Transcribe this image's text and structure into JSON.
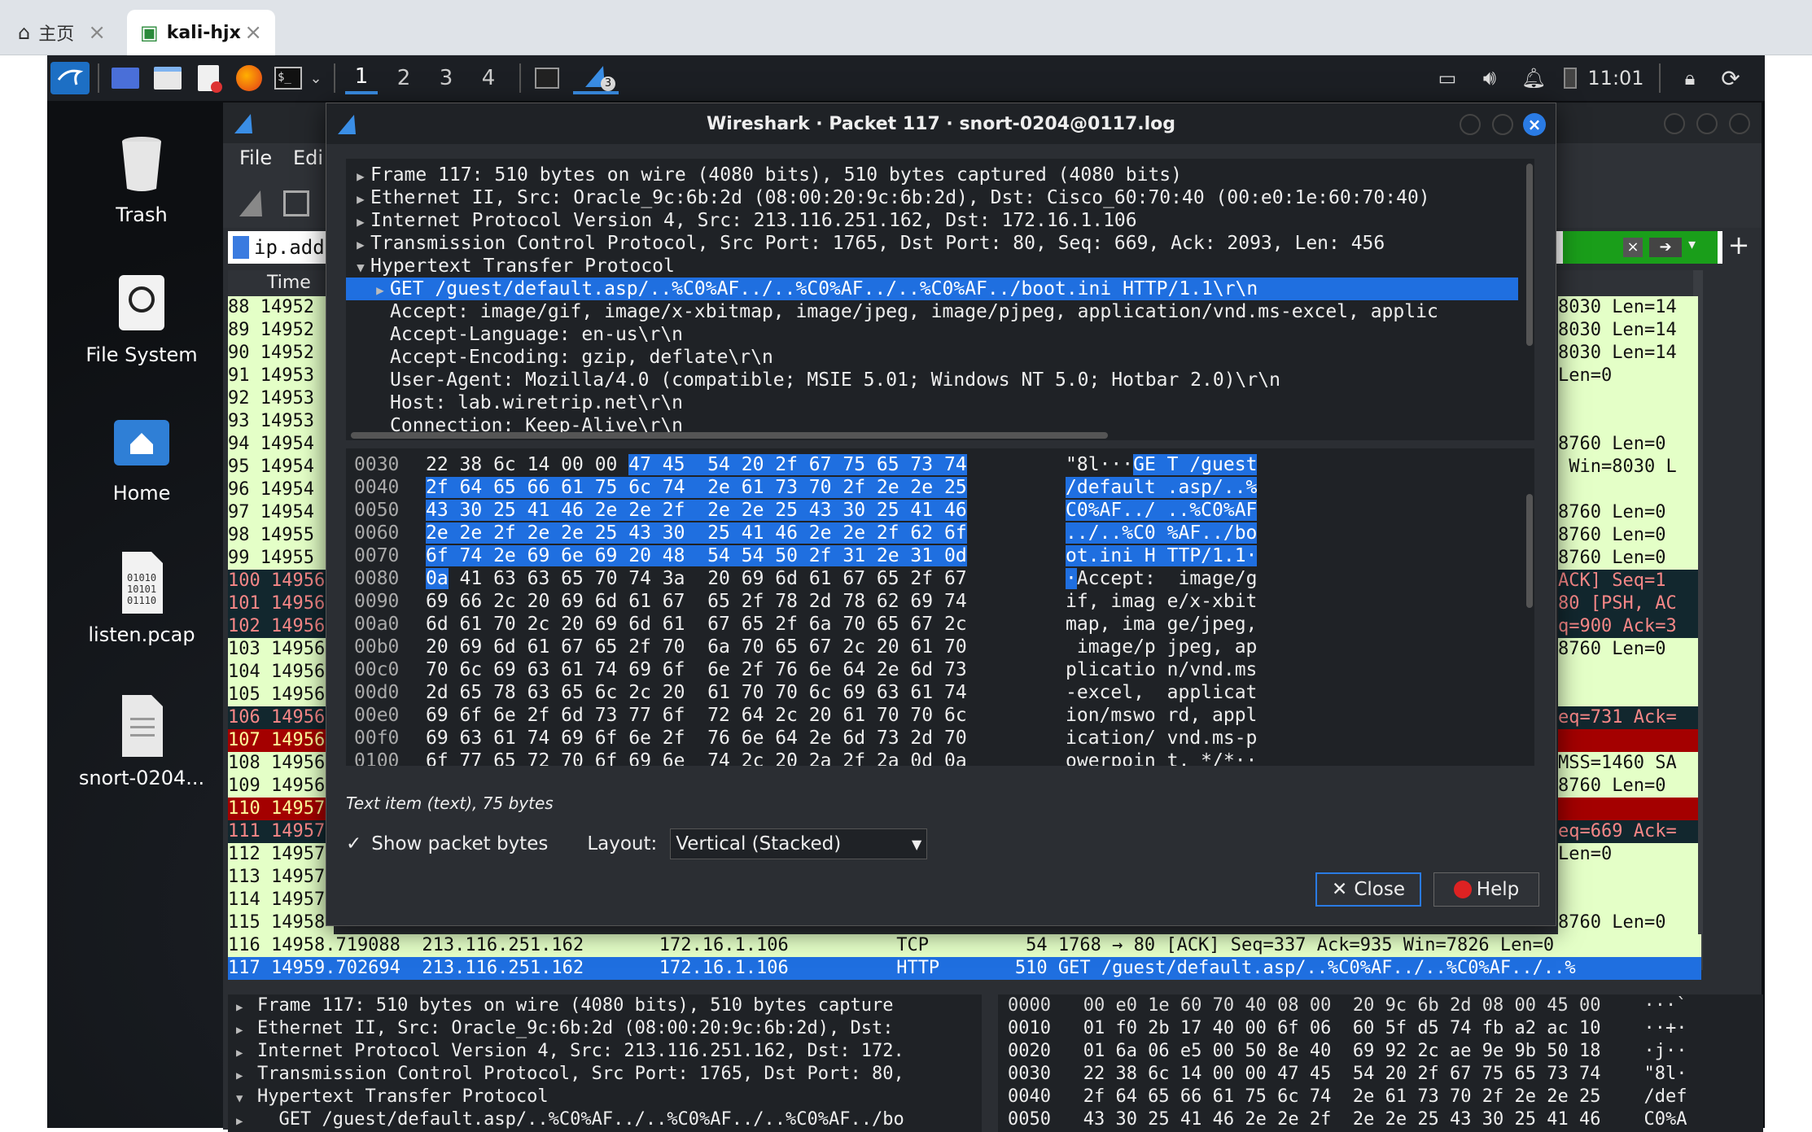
{
  "browser": {
    "tabs": [
      {
        "label": "主页",
        "icon": "home-icon"
      },
      {
        "label": "kali-hjx",
        "icon": "vm-icon"
      }
    ]
  },
  "panel": {
    "workspaces": [
      "1",
      "2",
      "3",
      "4"
    ],
    "wireshark_badge": "3",
    "clock": "11:01"
  },
  "desktop_icons": [
    {
      "label": "Trash",
      "icon": "trash-icon"
    },
    {
      "label": "File System",
      "icon": "drive-icon"
    },
    {
      "label": "Home",
      "icon": "home-folder-icon"
    },
    {
      "label": "listen.pcap",
      "icon": "binary-file-icon"
    },
    {
      "label": "snort-0204...",
      "icon": "text-file-icon"
    }
  ],
  "main": {
    "menu": [
      "File",
      "Edi"
    ],
    "filter_text": "ip.addr",
    "column_time": "Time",
    "rows": [
      {
        "text": "88 14952",
        "info": "8030 Len=14",
        "style": "green"
      },
      {
        "text": "89 14952",
        "info": "8030 Len=14",
        "style": "green"
      },
      {
        "text": "90 14952",
        "info": "8030 Len=14",
        "style": "green"
      },
      {
        "text": "91 14953",
        "info": "Len=0",
        "style": "green"
      },
      {
        "text": "92 14953",
        "info": "",
        "style": "green"
      },
      {
        "text": "93 14953",
        "info": "",
        "style": "green"
      },
      {
        "text": "94 14954",
        "info": "8760 Len=0",
        "style": "green"
      },
      {
        "text": "95 14954",
        "info": " Win=8030 L",
        "style": "green"
      },
      {
        "text": "96 14954",
        "info": "",
        "style": "green"
      },
      {
        "text": "97 14954",
        "info": "8760 Len=0",
        "style": "green"
      },
      {
        "text": "98 14955",
        "info": "8760 Len=0",
        "style": "green"
      },
      {
        "text": "99 14955",
        "info": "8760 Len=0",
        "style": "green"
      },
      {
        "text": "100 14956",
        "info": "ACK] Seq=1",
        "style": "dark"
      },
      {
        "text": "101 14956",
        "info": "80 [PSH, AC",
        "style": "dark"
      },
      {
        "text": "102 14956",
        "info": "q=900 Ack=3",
        "style": "dark"
      },
      {
        "text": "103 14956",
        "info": "8760 Len=0",
        "style": "green"
      },
      {
        "text": "104 14956",
        "info": "",
        "style": "green"
      },
      {
        "text": "105 14956",
        "info": "",
        "style": "green"
      },
      {
        "text": "106 14956",
        "info": "eq=731 Ack=",
        "style": "dark"
      },
      {
        "text": "107 14956",
        "info": "",
        "style": "red"
      },
      {
        "text": "108 14956",
        "info": "MSS=1460 SA",
        "style": "green"
      },
      {
        "text": "109 14956",
        "info": "8760 Len=0",
        "style": "green"
      },
      {
        "text": "110 14957",
        "info": "",
        "style": "red"
      },
      {
        "text": "111 14957",
        "info": "eq=669 Ack=",
        "style": "dark"
      },
      {
        "text": "112 14957",
        "info": "Len=0",
        "style": "green"
      },
      {
        "text": "113 14957",
        "info": "",
        "style": "green"
      },
      {
        "text": "114 14957",
        "info": "",
        "style": "green"
      },
      {
        "text": "115 14958",
        "info": "8760 Len=0",
        "style": "green"
      },
      {
        "text": "116 14958.719088  213.116.251.162       172.16.1.106          TCP         54 1768 → 80 [ACK] Seq=337 Ack=935 Win=7826 Len=0",
        "info": "",
        "style": "green-full"
      },
      {
        "text": "117 14959.702694  213.116.251.162       172.16.1.106          HTTP       510 GET /guest/default.asp/..%C0%AF../..%C0%AF../..%",
        "info": "",
        "style": "sel"
      }
    ],
    "detail_lines": [
      "Frame 117: 510 bytes on wire (4080 bits), 510 bytes capture",
      "Ethernet II, Src: Oracle_9c:6b:2d (08:00:20:9c:6b:2d), Dst:",
      "Internet Protocol Version 4, Src: 213.116.251.162, Dst: 172.",
      "Transmission Control Protocol, Src Port: 1765, Dst Port: 80,",
      "Hypertext Transfer Protocol",
      "  GET /guest/default.asp/..%C0%AF../..%C0%AF../..%C0%AF../bo"
    ],
    "bytes_lines": [
      "0000   00 e0 1e 60 70 40 08 00  20 9c 6b 2d 08 00 45 00    ···`",
      "0010   01 f0 2b 17 40 00 6f 06  60 5f d5 74 fb a2 ac 10    ··+·",
      "0020   01 6a 06 e5 00 50 8e 40  69 92 2c ae 9e 9b 50 18    ·j··",
      "0030   22 38 6c 14 00 00 47 45  54 20 2f 67 75 65 73 74    \"8l·",
      "0040   2f 64 65 66 61 75 6c 74  2e 61 73 70 2f 2e 2e 25    /def",
      "0050   43 30 25 41 46 2e 2e 2f  2e 2e 25 43 30 25 41 46    C0%A"
    ]
  },
  "dialog": {
    "title": "Wireshark · Packet 117 · snort-0204@0117.log",
    "tree": [
      {
        "text": "Frame 117: 510 bytes on wire (4080 bits), 510 bytes captured (4080 bits)",
        "arrow": "▶",
        "indent": 0
      },
      {
        "text": "Ethernet II, Src: Oracle_9c:6b:2d (08:00:20:9c:6b:2d), Dst: Cisco_60:70:40 (00:e0:1e:60:70:40)",
        "arrow": "▶",
        "indent": 0
      },
      {
        "text": "Internet Protocol Version 4, Src: 213.116.251.162, Dst: 172.16.1.106",
        "arrow": "▶",
        "indent": 0
      },
      {
        "text": "Transmission Control Protocol, Src Port: 1765, Dst Port: 80, Seq: 669, Ack: 2093, Len: 456",
        "arrow": "▶",
        "indent": 0
      },
      {
        "text": "Hypertext Transfer Protocol",
        "arrow": "▼",
        "indent": 0
      },
      {
        "text": "GET /guest/default.asp/..%C0%AF../..%C0%AF../..%C0%AF../boot.ini HTTP/1.1\\r\\n",
        "arrow": "▶",
        "indent": 1,
        "selected": true
      },
      {
        "text": "Accept: image/gif, image/x-xbitmap, image/jpeg, image/pjpeg, application/vnd.ms-excel, applic",
        "arrow": "",
        "indent": 1
      },
      {
        "text": "Accept-Language: en-us\\r\\n",
        "arrow": "",
        "indent": 1
      },
      {
        "text": "Accept-Encoding: gzip, deflate\\r\\n",
        "arrow": "",
        "indent": 1
      },
      {
        "text": "User-Agent: Mozilla/4.0 (compatible; MSIE 5.01; Windows NT 5.0; Hotbar 2.0)\\r\\n",
        "arrow": "",
        "indent": 1
      },
      {
        "text": "Host: lab.wiretrip.net\\r\\n",
        "arrow": "",
        "indent": 1
      },
      {
        "text": "Connection: Keep-Alive\\r\\n",
        "arrow": "",
        "indent": 1
      }
    ],
    "bytes": [
      {
        "off": "0030",
        "plain_a": "22 38 6c 14 00 00 ",
        "hl_a": "47 45  54 20 2f 67 75 65 73 74",
        "plain_b": "",
        "asc_plain": "\"8l···",
        "asc_hl": "GE T /guest",
        "asc_rest": ""
      },
      {
        "off": "0040",
        "plain_a": "",
        "hl_a": "2f 64 65 66 61 75 6c 74  2e 61 73 70 2f 2e 2e 25",
        "plain_b": "",
        "asc_plain": "",
        "asc_hl": "/default .asp/..%",
        "asc_rest": ""
      },
      {
        "off": "0050",
        "plain_a": "",
        "hl_a": "43 30 25 41 46 2e 2e 2f  2e 2e 25 43 30 25 41 46",
        "plain_b": "",
        "asc_plain": "",
        "asc_hl": "C0%AF../ ..%C0%AF",
        "asc_rest": ""
      },
      {
        "off": "0060",
        "plain_a": "",
        "hl_a": "2e 2e 2f 2e 2e 25 43 30  25 41 46 2e 2e 2f 62 6f",
        "plain_b": "",
        "asc_plain": "",
        "asc_hl": "../..%C0 %AF../bo",
        "asc_rest": ""
      },
      {
        "off": "0070",
        "plain_a": "",
        "hl_a": "6f 74 2e 69 6e 69 20 48  54 54 50 2f 31 2e 31 0d",
        "plain_b": "",
        "asc_plain": "",
        "asc_hl": "ot.ini H TTP/1.1·",
        "asc_rest": ""
      },
      {
        "off": "0080",
        "plain_a": "",
        "hl_a": "0a",
        "plain_b": " 41 63 63 65 70 74 3a  20 69 6d 61 67 65 2f 67",
        "asc_plain": "",
        "asc_hl": "·",
        "asc_rest": "Accept:  image/g"
      },
      {
        "off": "0090",
        "plain_a": "69 66 2c 20 69 6d 61 67  65 2f 78 2d 78 62 69 74",
        "hl_a": "",
        "plain_b": "",
        "asc_plain": "if, imag e/x-xbit",
        "asc_hl": "",
        "asc_rest": ""
      },
      {
        "off": "00a0",
        "plain_a": "6d 61 70 2c 20 69 6d 61  67 65 2f 6a 70 65 67 2c",
        "hl_a": "",
        "plain_b": "",
        "asc_plain": "map, ima ge/jpeg,",
        "asc_hl": "",
        "asc_rest": ""
      },
      {
        "off": "00b0",
        "plain_a": "20 69 6d 61 67 65 2f 70  6a 70 65 67 2c 20 61 70",
        "hl_a": "",
        "plain_b": "",
        "asc_plain": " image/p jpeg, ap",
        "asc_hl": "",
        "asc_rest": ""
      },
      {
        "off": "00c0",
        "plain_a": "70 6c 69 63 61 74 69 6f  6e 2f 76 6e 64 2e 6d 73",
        "hl_a": "",
        "plain_b": "",
        "asc_plain": "plicatio n/vnd.ms",
        "asc_hl": "",
        "asc_rest": ""
      },
      {
        "off": "00d0",
        "plain_a": "2d 65 78 63 65 6c 2c 20  61 70 70 6c 69 63 61 74",
        "hl_a": "",
        "plain_b": "",
        "asc_plain": "-excel,  applicat",
        "asc_hl": "",
        "asc_rest": ""
      },
      {
        "off": "00e0",
        "plain_a": "69 6f 6e 2f 6d 73 77 6f  72 64 2c 20 61 70 70 6c",
        "hl_a": "",
        "plain_b": "",
        "asc_plain": "ion/mswo rd, appl",
        "asc_hl": "",
        "asc_rest": ""
      },
      {
        "off": "00f0",
        "plain_a": "69 63 61 74 69 6f 6e 2f  76 6e 64 2e 6d 73 2d 70",
        "hl_a": "",
        "plain_b": "",
        "asc_plain": "ication/ vnd.ms-p",
        "asc_hl": "",
        "asc_rest": ""
      },
      {
        "off": "0100",
        "plain_a": "6f 77 65 72 70 6f 69 6e  74 2c 20 2a 2f 2a 0d 0a",
        "hl_a": "",
        "plain_b": "",
        "asc_plain": "owerpoin t, */*··",
        "asc_hl": "",
        "asc_rest": ""
      }
    ],
    "status": "Text item (text), 75 bytes",
    "show_bytes_label": "Show packet bytes",
    "show_bytes_checked": true,
    "layout_label": "Layout:",
    "layout_value": "Vertical (Stacked)",
    "close_label": "Close",
    "help_label": "Help"
  },
  "colors": {
    "selection": "#1f6fe0",
    "row_green": "#e4ffc7",
    "row_dark": "#12272e",
    "row_red": "#a40000"
  }
}
